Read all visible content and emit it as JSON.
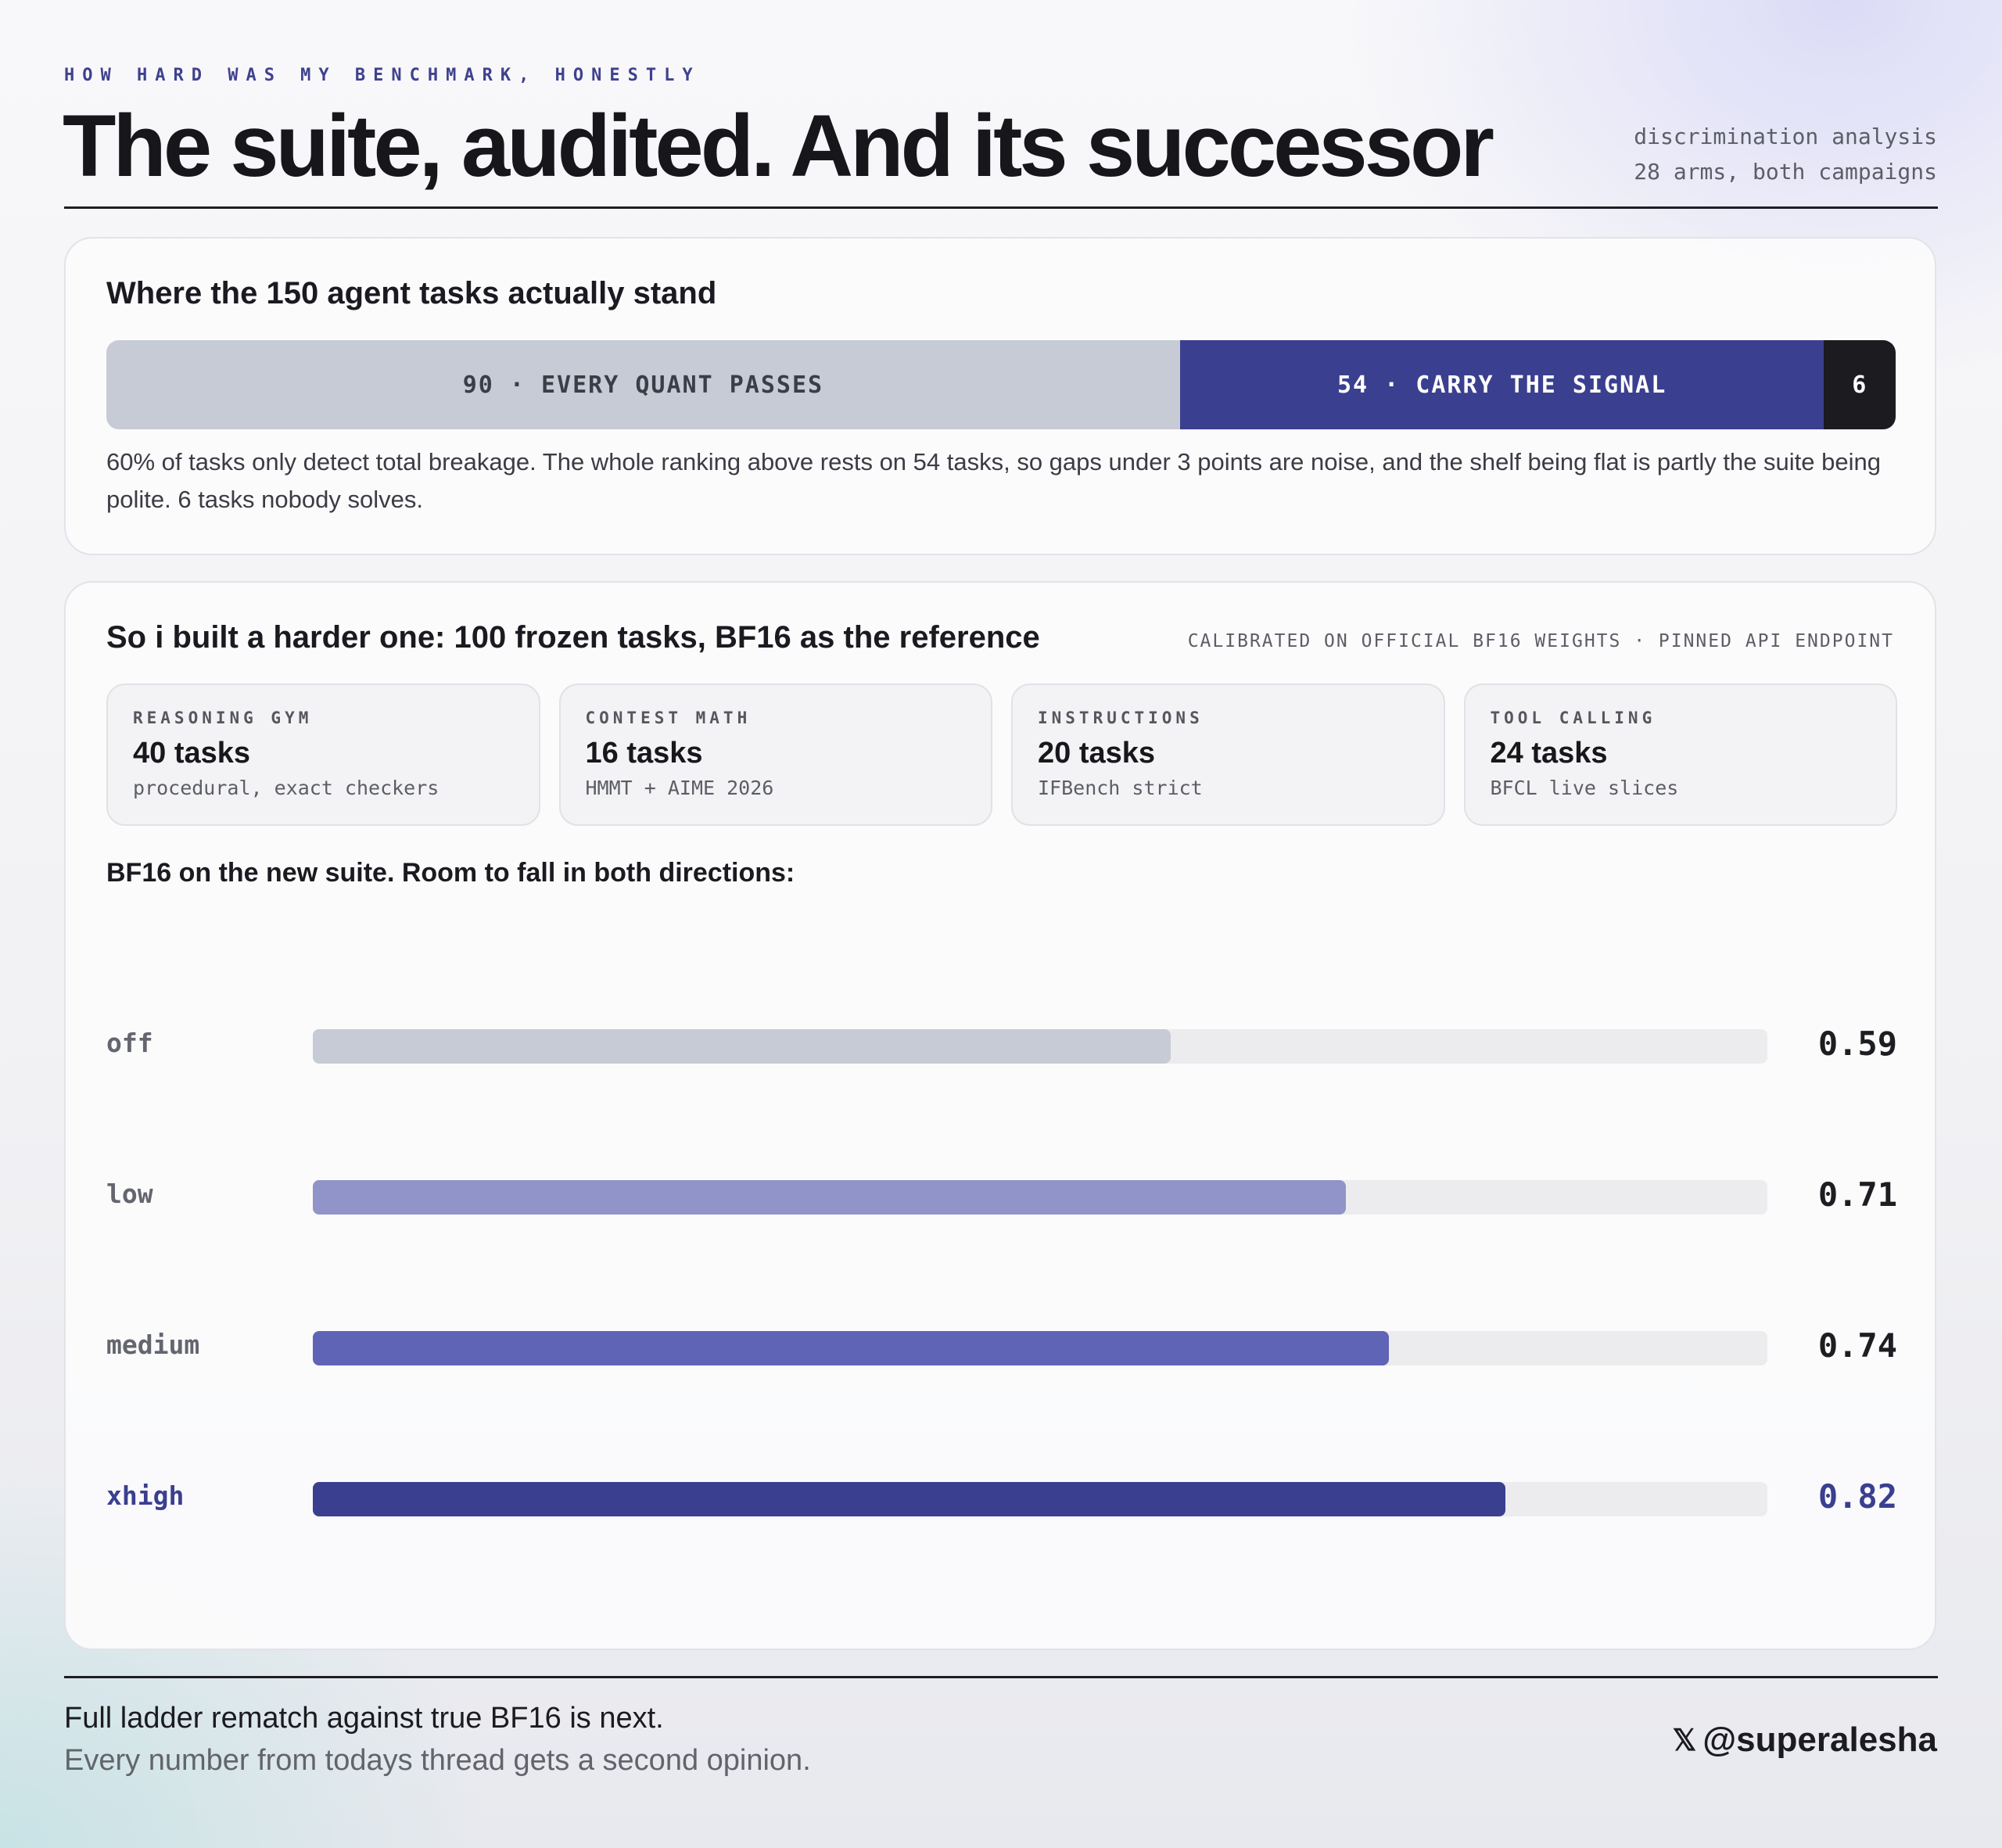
{
  "header": {
    "eyebrow": "HOW HARD WAS MY BENCHMARK, HONESTLY",
    "title": "The suite, audited. And its successor",
    "meta_line1": "discrimination analysis",
    "meta_line2": "28 arms, both campaigns"
  },
  "audit": {
    "title": "Where the 150 agent tasks actually stand",
    "segments": [
      {
        "label": "90 · EVERY QUANT PASSES",
        "value": 90,
        "color": "#c7cbd5"
      },
      {
        "label": "54 · CARRY THE SIGNAL",
        "value": 54,
        "color": "#3b3f8f"
      },
      {
        "label": "6",
        "value": 6,
        "color": "#1b1b20"
      }
    ],
    "note": "60% of tasks only detect total breakage. The whole ranking above rests on 54 tasks, so gaps under 3 points are noise, and the shelf being flat is partly the suite being polite. 6 tasks nobody solves."
  },
  "successor": {
    "title": "So i built a harder one: 100 frozen tasks, BF16 as the reference",
    "caption": "CALIBRATED ON OFFICIAL BF16 WEIGHTS · PINNED API ENDPOINT",
    "tiles": [
      {
        "label": "REASONING GYM",
        "count": "40 tasks",
        "sub": "procedural, exact checkers"
      },
      {
        "label": "CONTEST MATH",
        "count": "16 tasks",
        "sub": "HMMT + AIME 2026"
      },
      {
        "label": "INSTRUCTIONS",
        "count": "20 tasks",
        "sub": "IFBench strict"
      },
      {
        "label": "TOOL CALLING",
        "count": "24 tasks",
        "sub": "BFCL live slices"
      }
    ],
    "subhead": "BF16 on the new suite. Room to fall in both directions:"
  },
  "chart_data": {
    "type": "bar",
    "orientation": "horizontal",
    "categories": [
      "off",
      "low",
      "medium",
      "xhigh"
    ],
    "values": [
      0.59,
      0.71,
      0.74,
      0.82
    ],
    "value_labels": [
      "0.59",
      "0.71",
      "0.74",
      "0.82"
    ],
    "colors": [
      "#c7cbd5",
      "#9194c9",
      "#6064b6",
      "#3b3f8f"
    ],
    "highlight": "xhigh",
    "xlim": [
      0,
      1
    ]
  },
  "footer": {
    "line1": "Full ladder rematch against true BF16 is next.",
    "line2": "Every number from todays thread gets a second opinion.",
    "handle": "@superalesha",
    "icon": "x-logo-icon"
  }
}
